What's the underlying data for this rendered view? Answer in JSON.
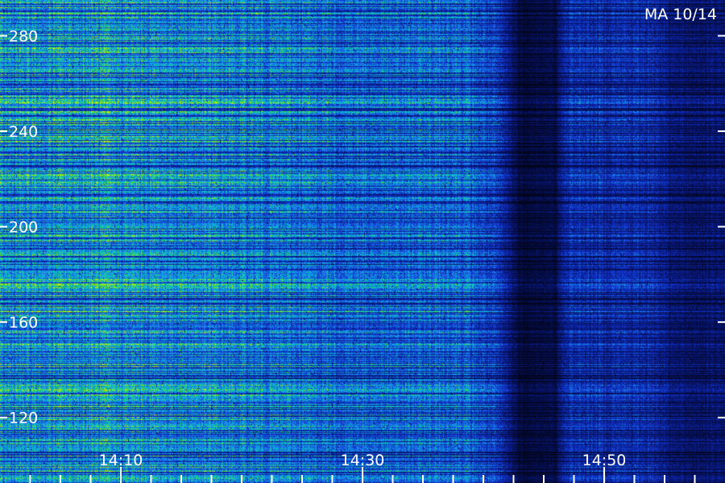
{
  "chart_data": {
    "type": "heatmap",
    "title": "MA 10/14",
    "y_ticks": [
      120,
      160,
      200,
      240,
      280
    ],
    "ylim": [
      100,
      295
    ],
    "x_ticks": [
      {
        "label": "14:10",
        "minute": 10
      },
      {
        "label": "14:30",
        "minute": 30
      },
      {
        "label": "14:50",
        "minute": 50
      }
    ],
    "x_minor_tick_minutes": [
      2.5,
      5,
      7.5,
      12.5,
      15,
      17.5,
      20,
      22.5,
      25,
      27.5,
      32.5,
      35,
      37.5,
      40,
      42.5,
      45,
      47.5,
      52.5,
      55,
      57.5
    ],
    "xlim_minutes": [
      0,
      60
    ],
    "colormap": [
      "#000000",
      "#08146a",
      "#1030c8",
      "#1a6ee8",
      "#0ab4e0",
      "#18c890",
      "#5ee024",
      "#d2ee10"
    ],
    "intensity_profile_by_minute": [
      {
        "minute": 0,
        "level": 0.62
      },
      {
        "minute": 8,
        "level": 0.66
      },
      {
        "minute": 18,
        "level": 0.6
      },
      {
        "minute": 32,
        "level": 0.48
      },
      {
        "minute": 38,
        "level": 0.52
      },
      {
        "minute": 41,
        "level": 0.35
      },
      {
        "minute": 43,
        "level": 0.1
      },
      {
        "minute": 46,
        "level": 0.12
      },
      {
        "minute": 47,
        "level": 0.32
      },
      {
        "minute": 54,
        "level": 0.3
      },
      {
        "minute": 56,
        "level": 0.18
      },
      {
        "minute": 60,
        "level": 0.18
      }
    ]
  }
}
